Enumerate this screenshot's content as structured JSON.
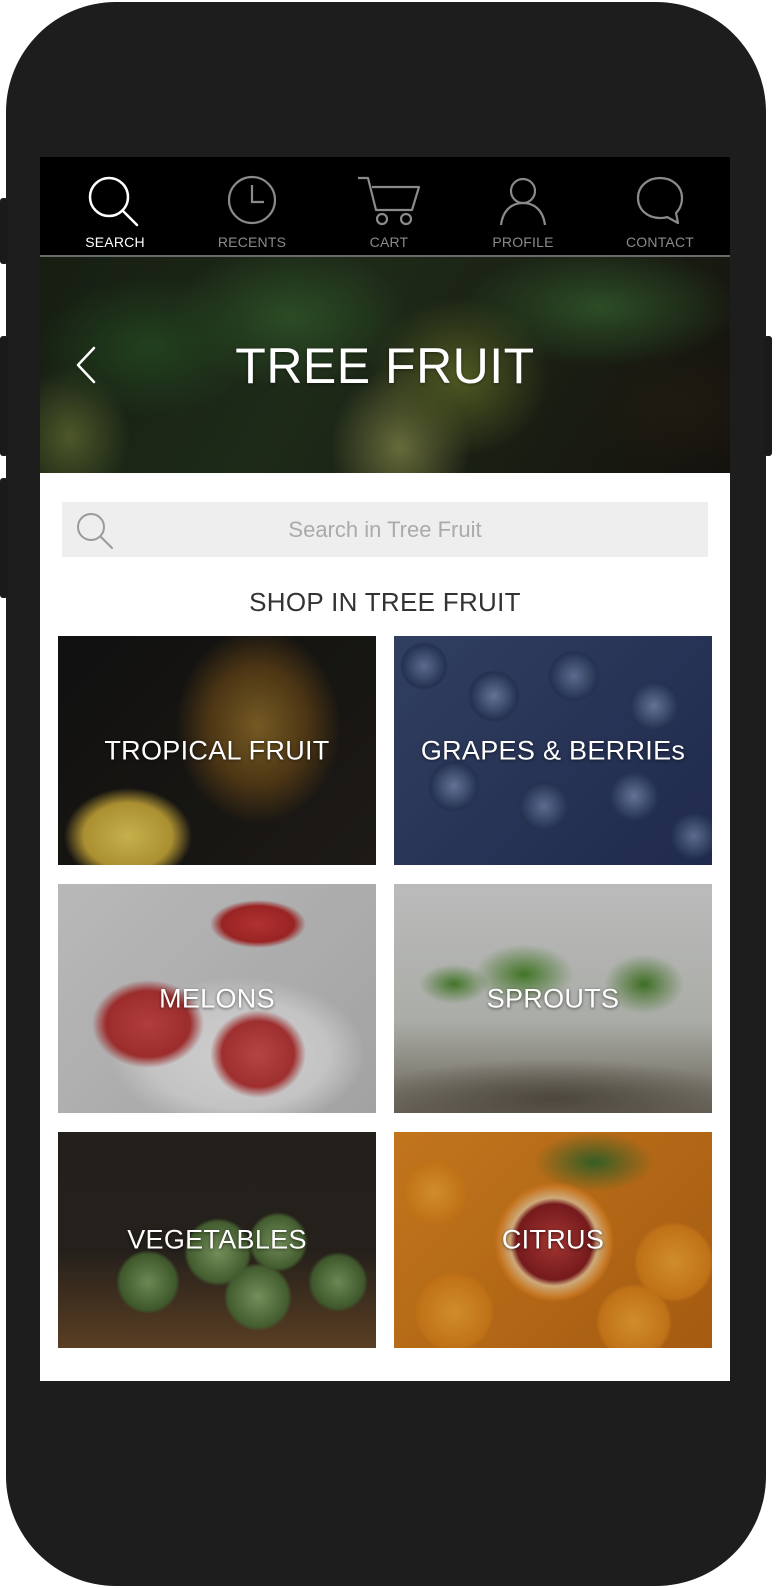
{
  "nav": {
    "items": [
      {
        "label": "SEARCH",
        "icon": "search-icon",
        "active": true
      },
      {
        "label": "RECENTS",
        "icon": "clock-icon",
        "active": false
      },
      {
        "label": "CART",
        "icon": "cart-icon",
        "active": false
      },
      {
        "label": "PROFILE",
        "icon": "user-icon",
        "active": false
      },
      {
        "label": "CONTACT",
        "icon": "chat-bubble-icon",
        "active": false
      }
    ]
  },
  "hero": {
    "title": "TREE FRUIT",
    "back_icon": "chevron-left-icon"
  },
  "search": {
    "placeholder": "Search in Tree Fruit",
    "value": ""
  },
  "section": {
    "title": "SHOP IN TREE FRUIT"
  },
  "categories": [
    {
      "label": "TROPICAL FRUIT"
    },
    {
      "label": "GRAPES & BERRIEs"
    },
    {
      "label": "MELONS"
    },
    {
      "label": "SPROUTS"
    },
    {
      "label": "VEGETABLES"
    },
    {
      "label": "CITRUS"
    }
  ],
  "colors": {
    "nav_background": "#000000",
    "nav_active": "#ffffff",
    "nav_inactive": "#8a8a8a",
    "device_frame": "#1d1d1d",
    "search_background": "#eeeeee"
  }
}
